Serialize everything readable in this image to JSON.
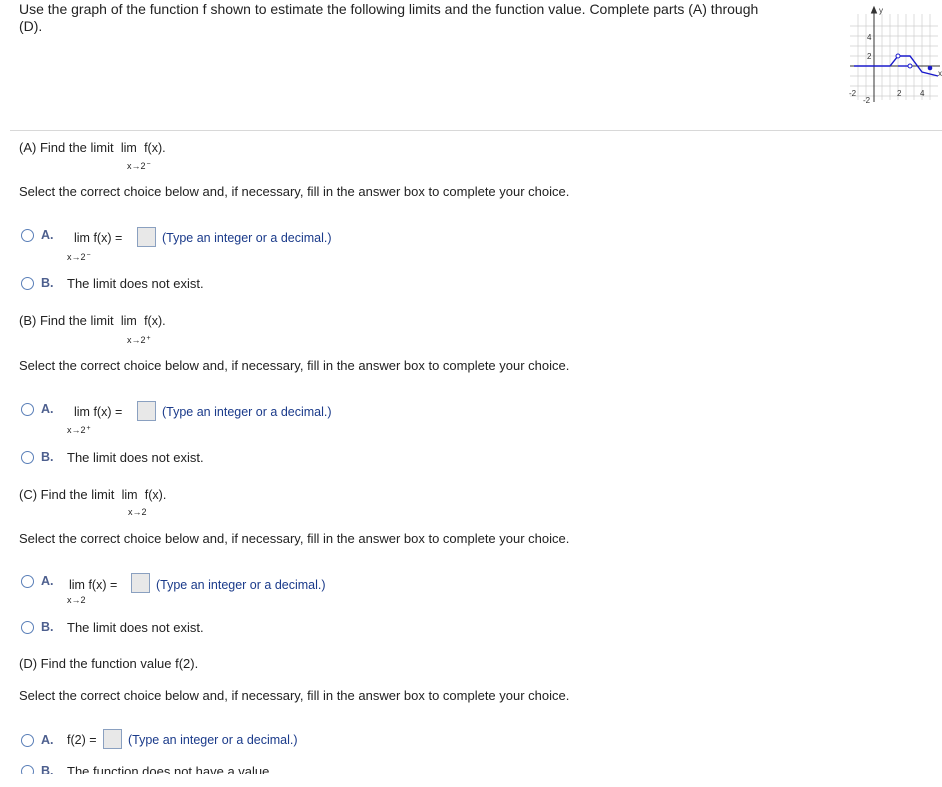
{
  "intro": {
    "line1": "Use the graph of the function f shown to estimate the following limits and the function value. Complete parts (A) through",
    "line2": "(D)."
  },
  "graph": {
    "y_axis_label": "y",
    "x_axis_label": "x",
    "y_ticks": [
      "4",
      "2",
      "-2"
    ],
    "x_ticks": [
      "-2",
      "2",
      "4"
    ],
    "axis_color": "#333333",
    "curve_color": "#1a1acc"
  },
  "parts": [
    {
      "prompt": "(A) Find the limit",
      "lim_word": "lim",
      "lim_func": "f(x).",
      "lim_sub": "x→2",
      "lim_sup": "−",
      "select_text": "Select the correct choice below and, if necessary, fill in the answer box to complete your choice.",
      "choice_a_letter": "A.",
      "choice_a_expr": "lim  f(x) =",
      "choice_a_sub": "x→2",
      "choice_a_sup": "−",
      "choice_a_hint": "(Type an integer or a decimal.)",
      "choice_b_letter": "B.",
      "choice_b_text": "The limit does not exist."
    },
    {
      "prompt": "(B) Find the limit",
      "lim_word": "lim",
      "lim_func": "f(x).",
      "lim_sub": "x→2",
      "lim_sup": "+",
      "select_text": "Select the correct choice below and, if necessary, fill in the answer box to complete your choice.",
      "choice_a_letter": "A.",
      "choice_a_expr": "lim  f(x) =",
      "choice_a_sub": "x→2",
      "choice_a_sup": "+",
      "choice_a_hint": "(Type an integer or a decimal.)",
      "choice_b_letter": "B.",
      "choice_b_text": "The limit does not exist."
    },
    {
      "prompt": "(C) Find the limit",
      "lim_word": "lim",
      "lim_func": "f(x).",
      "lim_sub": "x→2",
      "lim_sup": "",
      "select_text": "Select the correct choice below and, if necessary, fill in the answer box to complete your choice.",
      "choice_a_letter": "A.",
      "choice_a_expr": "lim  f(x) =",
      "choice_a_sub": "x→2",
      "choice_a_sup": "",
      "choice_a_hint": "(Type an integer or a decimal.)",
      "choice_b_letter": "B.",
      "choice_b_text": "The limit does not exist."
    },
    {
      "prompt": "(D) Find the function value f(2).",
      "select_text": "Select the correct choice below and, if necessary, fill in the answer box to complete your choice.",
      "choice_a_letter": "A.",
      "choice_a_expr": "f(2) =",
      "choice_a_hint": "(Type an integer or a decimal.)",
      "choice_b_letter": "B.",
      "choice_b_text": "The function does not have a value."
    }
  ]
}
